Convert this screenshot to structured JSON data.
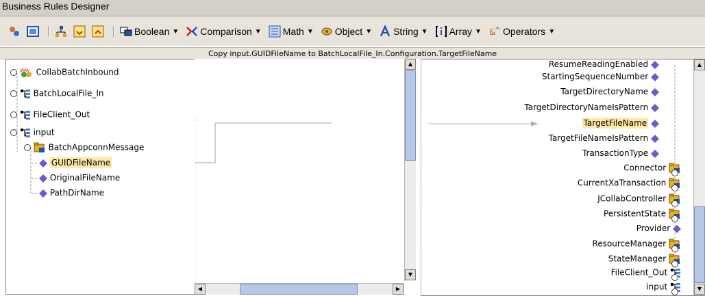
{
  "window": {
    "title": "Business Rules Designer"
  },
  "toolbar": {
    "menus": [
      {
        "label": "Boolean",
        "icon": "boolean-icon"
      },
      {
        "label": "Comparison",
        "icon": "comparison-icon"
      },
      {
        "label": "Math",
        "icon": "math-icon"
      },
      {
        "label": "Object",
        "icon": "object-icon"
      },
      {
        "label": "String",
        "icon": "string-icon"
      },
      {
        "label": "Array",
        "icon": "array-icon"
      },
      {
        "label": "Operators",
        "icon": "operators-icon"
      }
    ]
  },
  "info": {
    "text": "Copy input.GUIDFileName to BatchLocalFile_In.Configuration.TargetFileName"
  },
  "left_tree": {
    "items": [
      {
        "label": "CollabBatchInbound",
        "level": 0,
        "icon": "java-class-icon"
      },
      {
        "label": "BatchLocalFile_In",
        "level": 0,
        "icon": "node-icon"
      },
      {
        "label": "FileClient_Out",
        "level": 0,
        "icon": "node-icon"
      },
      {
        "label": "input",
        "level": 0,
        "icon": "node-icon"
      },
      {
        "label": "BatchAppconnMessage",
        "level": 1,
        "icon": "folder-icon"
      },
      {
        "label": "GUIDFileName",
        "level": 2,
        "icon": "diamond-icon",
        "selected": true
      },
      {
        "label": "OriginalFileName",
        "level": 2,
        "icon": "diamond-icon"
      },
      {
        "label": "PathDirName",
        "level": 2,
        "icon": "diamond-icon"
      }
    ]
  },
  "right_tree": {
    "items": [
      {
        "label": "ResumeReadingEnabled",
        "icon": "diamond-icon"
      },
      {
        "label": "StartingSequenceNumber",
        "icon": "diamond-icon"
      },
      {
        "label": "TargetDirectoryName",
        "icon": "diamond-icon"
      },
      {
        "label": "TargetDirectoryNameIsPattern",
        "icon": "diamond-icon"
      },
      {
        "label": "TargetFileName",
        "icon": "diamond-icon",
        "selected": true
      },
      {
        "label": "TargetFileNameIsPattern",
        "icon": "diamond-icon"
      },
      {
        "label": "TransactionType",
        "icon": "diamond-icon"
      },
      {
        "label": "Connector",
        "icon": "folder-icon"
      },
      {
        "label": "CurrentXaTransaction",
        "icon": "folder-icon"
      },
      {
        "label": "JCollabController",
        "icon": "folder-icon"
      },
      {
        "label": "PersistentState",
        "icon": "folder-icon"
      },
      {
        "label": "Provider",
        "icon": "diamond-icon"
      },
      {
        "label": "ResourceManager",
        "icon": "folder-icon"
      },
      {
        "label": "StateManager",
        "icon": "folder-icon"
      },
      {
        "label": "FileClient_Out",
        "icon": "node-icon"
      },
      {
        "label": "input",
        "icon": "node-icon"
      }
    ]
  },
  "colors": {
    "selection": "#ffe8a8",
    "diamond": "#6a5acd",
    "folder": "#e8b020",
    "node": "#4a7fd0"
  }
}
